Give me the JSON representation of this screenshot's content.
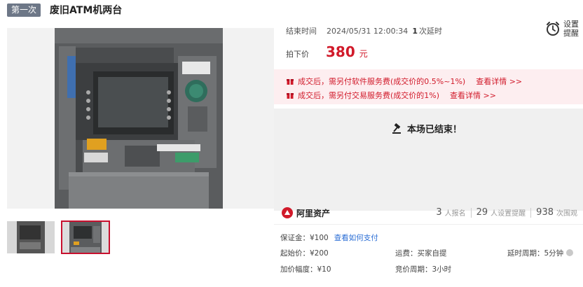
{
  "header": {
    "round_badge": "第一次",
    "title": "废旧ATM机两台"
  },
  "gallery": {
    "thumbnails": [
      "thumb-1",
      "thumb-2"
    ],
    "selected_index": 1
  },
  "auction": {
    "end_label": "结束时间",
    "end_time": "2024/05/31 12:00:34",
    "extension_count": "1",
    "extension_text": "次延时",
    "remind_line1": "设置",
    "remind_line2": "提醒",
    "price_label": "拍下价",
    "price_value": "380",
    "price_unit": "元"
  },
  "notices": [
    {
      "text": "成交后，需另付软件服务费(成交价的0.5%~1%)",
      "link": "查看详情 >>"
    },
    {
      "text": "成交后，需另付交易服务费(成交价的1%)",
      "link": "查看详情 >>"
    }
  ],
  "status": {
    "ended_text": "本场已结束！"
  },
  "brand": {
    "name": "阿里资产"
  },
  "stats": {
    "signups": "3",
    "signups_label": "人报名",
    "reminders": "29",
    "reminders_label": "人设置提醒",
    "views": "938",
    "views_label": "次围观"
  },
  "details": {
    "deposit": "保证金：¥100",
    "deposit_link": "查看如何支付",
    "start_price": "起始价：¥200",
    "shipping": "运费：买家自提",
    "delay_period": "延时周期：5分钟",
    "increment": "加价幅度：¥10",
    "bid_period": "竞价周期：3小时"
  },
  "colors": {
    "accent_red": "#d11a2a",
    "notice_bg": "#fdeef0",
    "badge_bg": "#6d7787",
    "link_blue": "#2a6dd5"
  }
}
